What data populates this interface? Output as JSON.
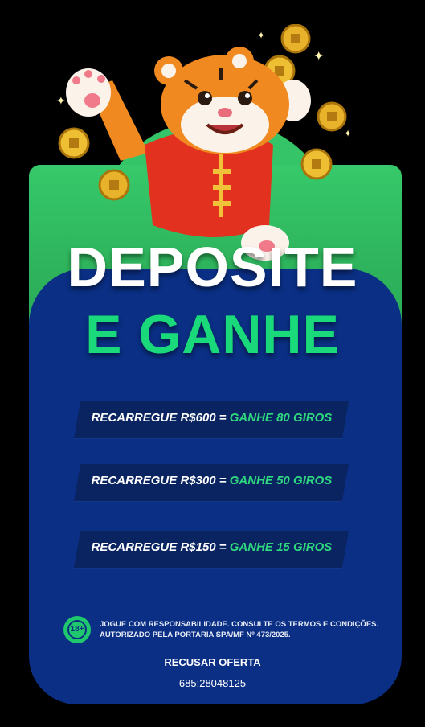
{
  "headline": {
    "line1": "DEPOSITE",
    "line2": "E GANHE"
  },
  "offers": [
    {
      "label": "RECARREGUE  R$600 = ",
      "reward": "GANHE 80 GIROS"
    },
    {
      "label": "RECARREGUE  R$300 = ",
      "reward": "GANHE 50 GIROS"
    },
    {
      "label": "RECARREGUE  R$150 = ",
      "reward": "GANHE 15 GIROS"
    }
  ],
  "responsible": {
    "badge": "18+",
    "line1": "JOGUE COM RESPONSABILIDADE. CONSULTE OS TERMOS E CONDIÇÕES.",
    "line2": "AUTORIZADO PELA PORTARIA SPA/MF Nº 473/2025."
  },
  "decline_label": "RECUSAR OFERTA",
  "code": "685:28048125",
  "colors": {
    "background": "#000000",
    "card_blue": "#0a2f84",
    "card_green": "#36c96a",
    "accent_green": "#19d97a"
  },
  "icons": {
    "mascot": "tiger-mascot",
    "coin": "gold-coin",
    "age_badge": "age-18-badge"
  }
}
